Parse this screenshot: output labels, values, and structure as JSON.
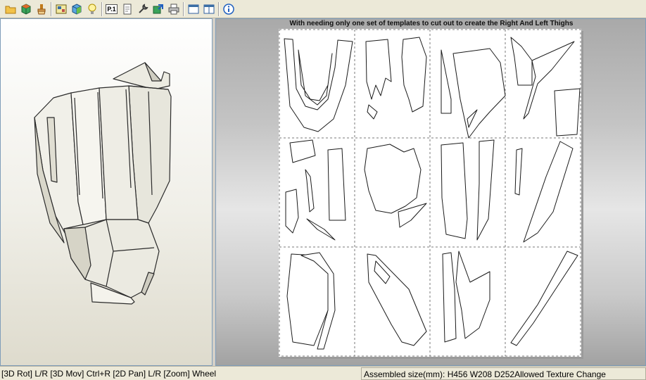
{
  "toolbar": {
    "buttons": [
      {
        "name": "open-icon",
        "color": "#e8a317"
      },
      {
        "name": "3d-view-icon",
        "color": "#2e8b57"
      },
      {
        "name": "glue-brush-icon",
        "color": "#c07a1a"
      },
      {
        "name": "2d-view-icon",
        "color": "#3a6ea5"
      },
      {
        "name": "texture-cube-icon",
        "color": "#3a9a3a"
      },
      {
        "name": "light-bulb-icon",
        "color": "#f2c300"
      },
      {
        "name": "page-number-icon",
        "color": "#333333"
      },
      {
        "name": "page-setup-icon",
        "color": "#6a6a6a"
      },
      {
        "name": "wrench-icon",
        "color": "#4a4a4a"
      },
      {
        "name": "export-icon",
        "color": "#2f8f2f"
      },
      {
        "name": "print-icon",
        "color": "#555555"
      },
      {
        "name": "window-single-icon",
        "color": "#3a6ea5"
      },
      {
        "name": "window-split-icon",
        "color": "#3a6ea5"
      },
      {
        "name": "info-icon",
        "color": "#1f5fbf"
      }
    ],
    "page_number_label": "P.1"
  },
  "layout_view": {
    "page_title": "With needing only one set of templates to cut out to create the Right And Left Thighs"
  },
  "status": {
    "controls_hint": "[3D Rot] L/R [3D Mov] Ctrl+R [2D Pan] L/R [Zoom] Wheel",
    "assembled_size": "Assembled size(mm): H456 W208 D252Allowed Texture Change"
  }
}
